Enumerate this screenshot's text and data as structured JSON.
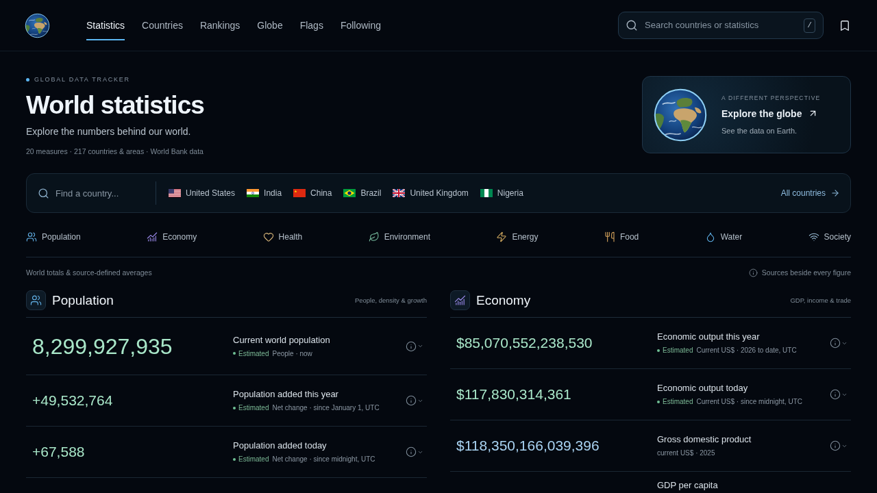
{
  "header": {
    "nav": [
      {
        "label": "Statistics",
        "selected": true
      },
      {
        "label": "Countries",
        "selected": false
      },
      {
        "label": "Rankings",
        "selected": false
      },
      {
        "label": "Globe",
        "selected": false
      },
      {
        "label": "Flags",
        "selected": false
      },
      {
        "label": "Following",
        "selected": false
      }
    ],
    "search": {
      "placeholder": "Search countries or statistics",
      "shortcut": "/"
    }
  },
  "hero": {
    "eyebrow": "GLOBAL DATA TRACKER",
    "title": "World statistics",
    "subtitle": "Explore the numbers behind our world.",
    "meta": "20 measures · 217 countries & areas · World Bank data"
  },
  "globe_card": {
    "eyebrow": "A DIFFERENT PERSPECTIVE",
    "title": "Explore the globe",
    "subtitle": "See the data on Earth."
  },
  "country_bar": {
    "search": {
      "placeholder": "Find a country..."
    },
    "countries": [
      "United States",
      "India",
      "China",
      "Brazil",
      "United Kingdom",
      "Nigeria"
    ],
    "all_link": "All countries"
  },
  "categories": [
    {
      "label": "Population"
    },
    {
      "label": "Economy"
    },
    {
      "label": "Health"
    },
    {
      "label": "Environment"
    },
    {
      "label": "Energy"
    },
    {
      "label": "Food"
    },
    {
      "label": "Water"
    },
    {
      "label": "Society"
    }
  ],
  "summary": {
    "note": "World totals & source-defined averages",
    "sources": "Sources beside every figure"
  },
  "sections": [
    {
      "title": "Population",
      "subtitle": "People, density & growth",
      "rows": [
        {
          "kind": "headline",
          "value": "8,299,927,935",
          "label": "Current world population",
          "badge": "Estimated",
          "meta": "People · now"
        },
        {
          "kind": "estimate",
          "value": "+49,532,764",
          "label": "Population added this year",
          "badge": "Estimated",
          "meta": "Net change · since January 1, UTC"
        },
        {
          "kind": "estimate",
          "value": "+67,588",
          "label": "Population added today",
          "badge": "Estimated",
          "meta": "Net change · since midnight, UTC"
        }
      ]
    },
    {
      "title": "Economy",
      "subtitle": "GDP, income & trade",
      "rows": [
        {
          "kind": "estimate",
          "value": "$85,070,552,238,530",
          "label": "Economic output this year",
          "badge": "Estimated",
          "meta": "Current US$ · 2026 to date, UTC"
        },
        {
          "kind": "estimate",
          "value": "$117,830,314,361",
          "label": "Economic output today",
          "badge": "Estimated",
          "meta": "Current US$ · since midnight, UTC"
        },
        {
          "kind": "reported",
          "value": "$118,350,166,039,396",
          "label": "Gross domestic product",
          "meta": "current US$ · 2025"
        },
        {
          "label": "GDP per capita"
        }
      ]
    }
  ]
}
